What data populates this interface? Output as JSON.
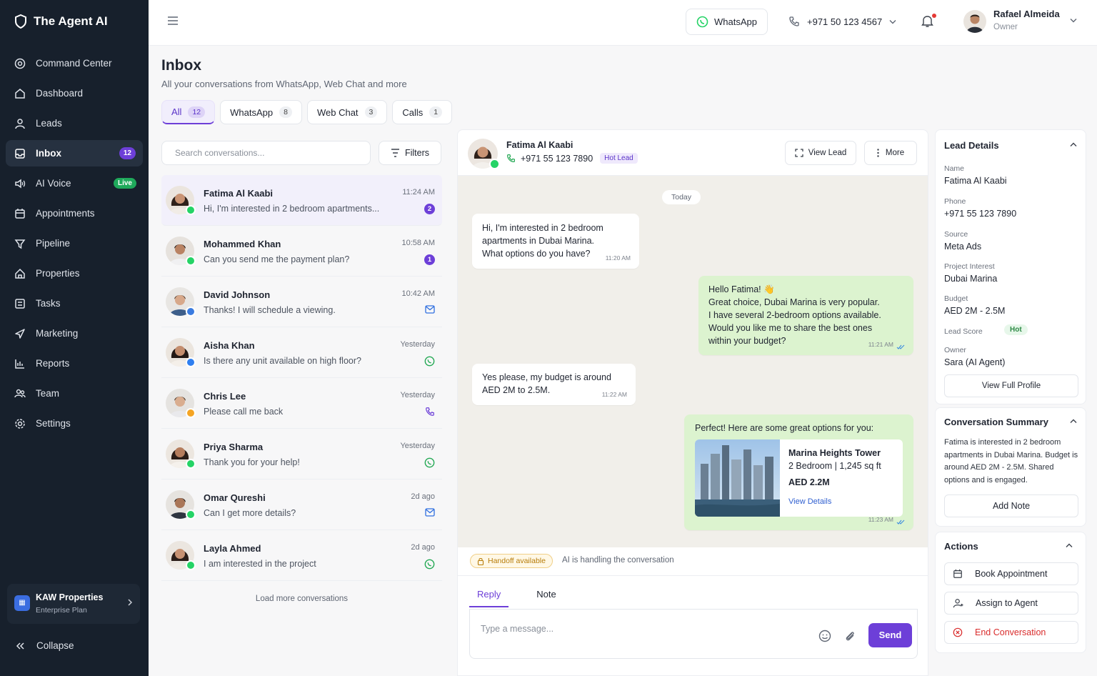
{
  "brand": {
    "name": "The Agent AI"
  },
  "sidebar": {
    "items": [
      {
        "label": "Command Center",
        "icon": "target-icon"
      },
      {
        "label": "Dashboard",
        "icon": "home-icon"
      },
      {
        "label": "Leads",
        "icon": "user-icon"
      },
      {
        "label": "Inbox",
        "icon": "inbox-icon",
        "badge": "12"
      },
      {
        "label": "AI Voice",
        "icon": "voice-icon",
        "badge": "Live"
      },
      {
        "label": "Appointments",
        "icon": "calendar-icon"
      },
      {
        "label": "Pipeline",
        "icon": "funnel-icon"
      },
      {
        "label": "Properties",
        "icon": "building-icon"
      },
      {
        "label": "Tasks",
        "icon": "checklist-icon"
      },
      {
        "label": "Marketing",
        "icon": "megaphone-icon"
      },
      {
        "label": "Reports",
        "icon": "bar-chart-icon"
      },
      {
        "label": "Team",
        "icon": "team-icon"
      },
      {
        "label": "Settings",
        "icon": "gear-icon"
      }
    ],
    "org": {
      "name": "KAW Properties",
      "plan": "Enterprise Plan"
    },
    "collapse_label": "Collapse"
  },
  "topbar": {
    "whatsapp_label": "WhatsApp",
    "phone": "+971 50 123 4567",
    "user": {
      "name": "Rafael Almeida",
      "role": "Owner"
    }
  },
  "inbox": {
    "title": "Inbox",
    "subtitle": "All your conversations from WhatsApp, Web Chat and more",
    "tabs": [
      {
        "label": "All",
        "count": "12"
      },
      {
        "label": "WhatsApp",
        "count": "8"
      },
      {
        "label": "Web Chat",
        "count": "3"
      },
      {
        "label": "Calls",
        "count": "1"
      }
    ],
    "search_placeholder": "Search conversations...",
    "filters_label": "Filters",
    "load_more": "Load more conversations"
  },
  "conversations": [
    {
      "name": "Fatima Al Kaabi",
      "message": "Hi, I'm interested in 2 bedroom apartments...",
      "time": "11:24 AM",
      "unread": "2",
      "channel": "whatsapp",
      "indicator": "unread"
    },
    {
      "name": "Mohammed Khan",
      "message": "Can you send me the payment plan?",
      "time": "10:58 AM",
      "unread": "1",
      "channel": "whatsapp",
      "indicator": "unread"
    },
    {
      "name": "David Johnson",
      "message": "Thanks! I will schedule a viewing.",
      "time": "10:42 AM",
      "channel": "webchat",
      "indicator": "mail"
    },
    {
      "name": "Aisha Khan",
      "message": "Is there any unit available on high floor?",
      "time": "Yesterday",
      "channel": "messenger",
      "indicator": "whatsapp"
    },
    {
      "name": "Chris Lee",
      "message": "Please call me back",
      "time": "Yesterday",
      "channel": "call",
      "indicator": "phone"
    },
    {
      "name": "Priya Sharma",
      "message": "Thank you for your help!",
      "time": "Yesterday",
      "channel": "whatsapp",
      "indicator": "whatsapp"
    },
    {
      "name": "Omar Qureshi",
      "message": "Can I get more details?",
      "time": "2d ago",
      "channel": "whatsapp",
      "indicator": "mail"
    },
    {
      "name": "Layla Ahmed",
      "message": "I am interested in the project",
      "time": "2d ago",
      "channel": "whatsapp",
      "indicator": "whatsapp"
    }
  ],
  "chat": {
    "name": "Fatima Al Kaabi",
    "phone": "+971 55 123 7890",
    "tag": "Hot Lead",
    "view_lead": "View Lead",
    "more": "More",
    "date_divider": "Today",
    "messages": [
      {
        "dir": "in",
        "lines": [
          "Hi, I'm interested in 2 bedroom",
          "apartments in Dubai Marina.",
          "What options do you have?"
        ],
        "time": "11:20 AM"
      },
      {
        "dir": "out",
        "lines": [
          "Hello Fatima! 👋",
          "Great choice, Dubai Marina is very popular.",
          "I have several 2-bedroom options available.",
          "Would you like me to share the best ones",
          "within your budget?"
        ],
        "time": "11:21 AM"
      },
      {
        "dir": "in",
        "lines": [
          "Yes please, my budget is around",
          "AED 2M to 2.5M."
        ],
        "time": "11:22 AM"
      },
      {
        "dir": "out",
        "lines": [
          "Perfect! Here are some great options for you:"
        ],
        "time": "11:23 AM"
      }
    ],
    "property": {
      "title": "Marina Heights Tower",
      "details": "2 Bedroom | 1,245 sq ft",
      "price": "AED 2.2M",
      "link": "View Details"
    },
    "handoff_tag": "Handoff available",
    "handoff_text": "AI is handling the conversation",
    "reply_tabs": [
      "Reply",
      "Note"
    ],
    "input_placeholder": "Type a message...",
    "send_label": "Send"
  },
  "lead": {
    "title": "Lead Details",
    "fields": [
      {
        "label": "Name",
        "value": "Fatima Al Kaabi"
      },
      {
        "label": "Phone",
        "value": "+971 55 123 7890"
      },
      {
        "label": "Source",
        "value": "Meta Ads"
      },
      {
        "label": "Project Interest",
        "value": "Dubai Marina"
      },
      {
        "label": "Budget",
        "value": "AED 2M - 2.5M"
      },
      {
        "label": "Lead Score",
        "value": "Hot"
      },
      {
        "label": "Owner",
        "value": "Sara (AI Agent)"
      }
    ],
    "profile_button": "View Full Profile"
  },
  "summary": {
    "title": "Conversation Summary",
    "text": "Fatima is interested in 2 bedroom apartments in Dubai Marina. Budget is around AED 2M - 2.5M. Shared options and is engaged.",
    "add_note": "Add Note"
  },
  "actions": {
    "title": "Actions",
    "items": [
      {
        "label": "Book Appointment",
        "icon": "calendar-icon"
      },
      {
        "label": "Assign to Agent",
        "icon": "user-assign-icon"
      },
      {
        "label": "End Conversation",
        "icon": "close-circle-icon"
      }
    ]
  },
  "colors": {
    "accent": "#6d3fd8",
    "sidebar_bg": "#17202c",
    "whatsapp": "#25d366",
    "danger": "#d92c2c"
  }
}
